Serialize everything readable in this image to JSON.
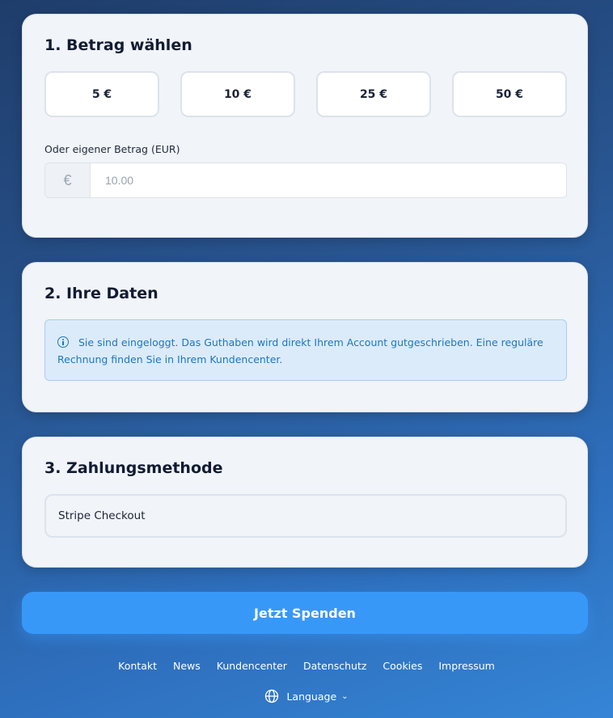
{
  "sections": {
    "amount": {
      "title": "1. Betrag wählen",
      "options": [
        "5 €",
        "10 €",
        "25 €",
        "50 €"
      ],
      "custom_label": "Oder eigener Betrag (EUR)",
      "currency_symbol": "€",
      "custom_placeholder": "10.00"
    },
    "data": {
      "title": "2. Ihre Daten",
      "info_text": "Sie sind eingeloggt. Das Guthaben wird direkt Ihrem Account gutgeschrieben. Eine reguläre Rechnung finden Sie in Ihrem Kundencenter."
    },
    "payment": {
      "title": "3. Zahlungsmethode",
      "method": "Stripe Checkout"
    }
  },
  "donate_button": "Jetzt Spenden",
  "footer": {
    "links": [
      "Kontakt",
      "News",
      "Kundencenter",
      "Datenschutz",
      "Cookies",
      "Impressum"
    ],
    "language_label": "Language",
    "icons": [
      "globe-icon",
      "chevron-down-icon",
      "info-circle-icon"
    ]
  },
  "colors": {
    "accent": "#3898f8",
    "info_text": "#1a78c2",
    "info_bg": "#dcebfa",
    "card_bg": "#f1f4f8"
  }
}
